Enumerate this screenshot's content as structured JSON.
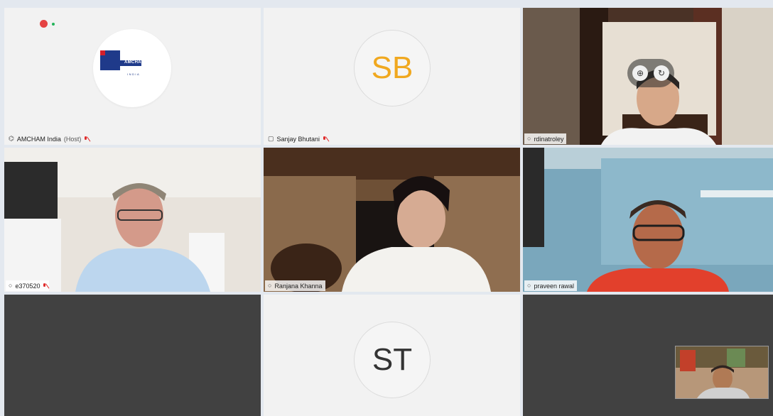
{
  "top_indicator": {
    "recording_dot_color": "#e54343",
    "status_dot_color": "#23b45a"
  },
  "tiles": [
    {
      "id": "t1",
      "name": "AMCHAM India",
      "suffix": "(Host)",
      "type": "logo",
      "muted": true,
      "logo_text": "AMCHAM",
      "logo_sub": "INDIA"
    },
    {
      "id": "t2",
      "name": "Sanjay Bhutani",
      "type": "initials",
      "initials": "SB",
      "initials_color": "#f0a81f",
      "muted": true
    },
    {
      "id": "t3",
      "name": "rdinatroley",
      "type": "video",
      "muted": false
    },
    {
      "id": "t4",
      "name": "e370520",
      "type": "video",
      "muted": true
    },
    {
      "id": "t5",
      "name": "Ranjana Khanna",
      "type": "video",
      "muted": false
    },
    {
      "id": "t6",
      "name": "praveen rawal",
      "type": "video",
      "muted": false,
      "active_speaker": true
    },
    {
      "id": "t7",
      "type": "empty"
    },
    {
      "id": "t8",
      "type": "initials",
      "initials": "ST",
      "initials_color": "#333333"
    },
    {
      "id": "t9",
      "type": "empty"
    }
  ]
}
